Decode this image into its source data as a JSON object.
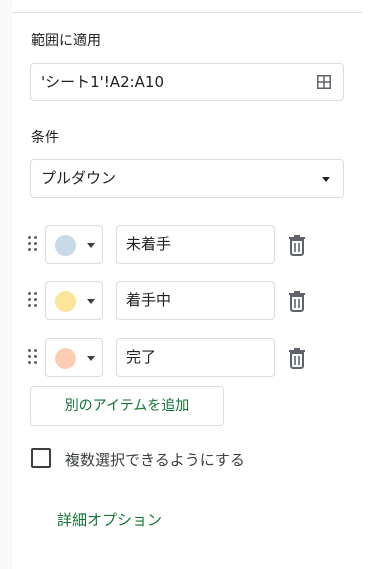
{
  "range": {
    "label": "範囲に適用",
    "value": "'シート1'!A2:A10",
    "icon": "grid-select-icon"
  },
  "condition": {
    "label": "条件",
    "value": "プルダウン"
  },
  "items": [
    {
      "value": "未着手",
      "color": "#c6dbe5"
    },
    {
      "value": "着手中",
      "color": "#fde49b"
    },
    {
      "value": "完了",
      "color": "#fecdb5"
    }
  ],
  "add_item_label": "別のアイテムを追加",
  "multi_select_label": "複数選択できるようにする",
  "multi_select_checked": false,
  "advanced_options_label": "詳細オプション",
  "colors": {
    "accent": "#137333",
    "border": "#dadce0"
  }
}
